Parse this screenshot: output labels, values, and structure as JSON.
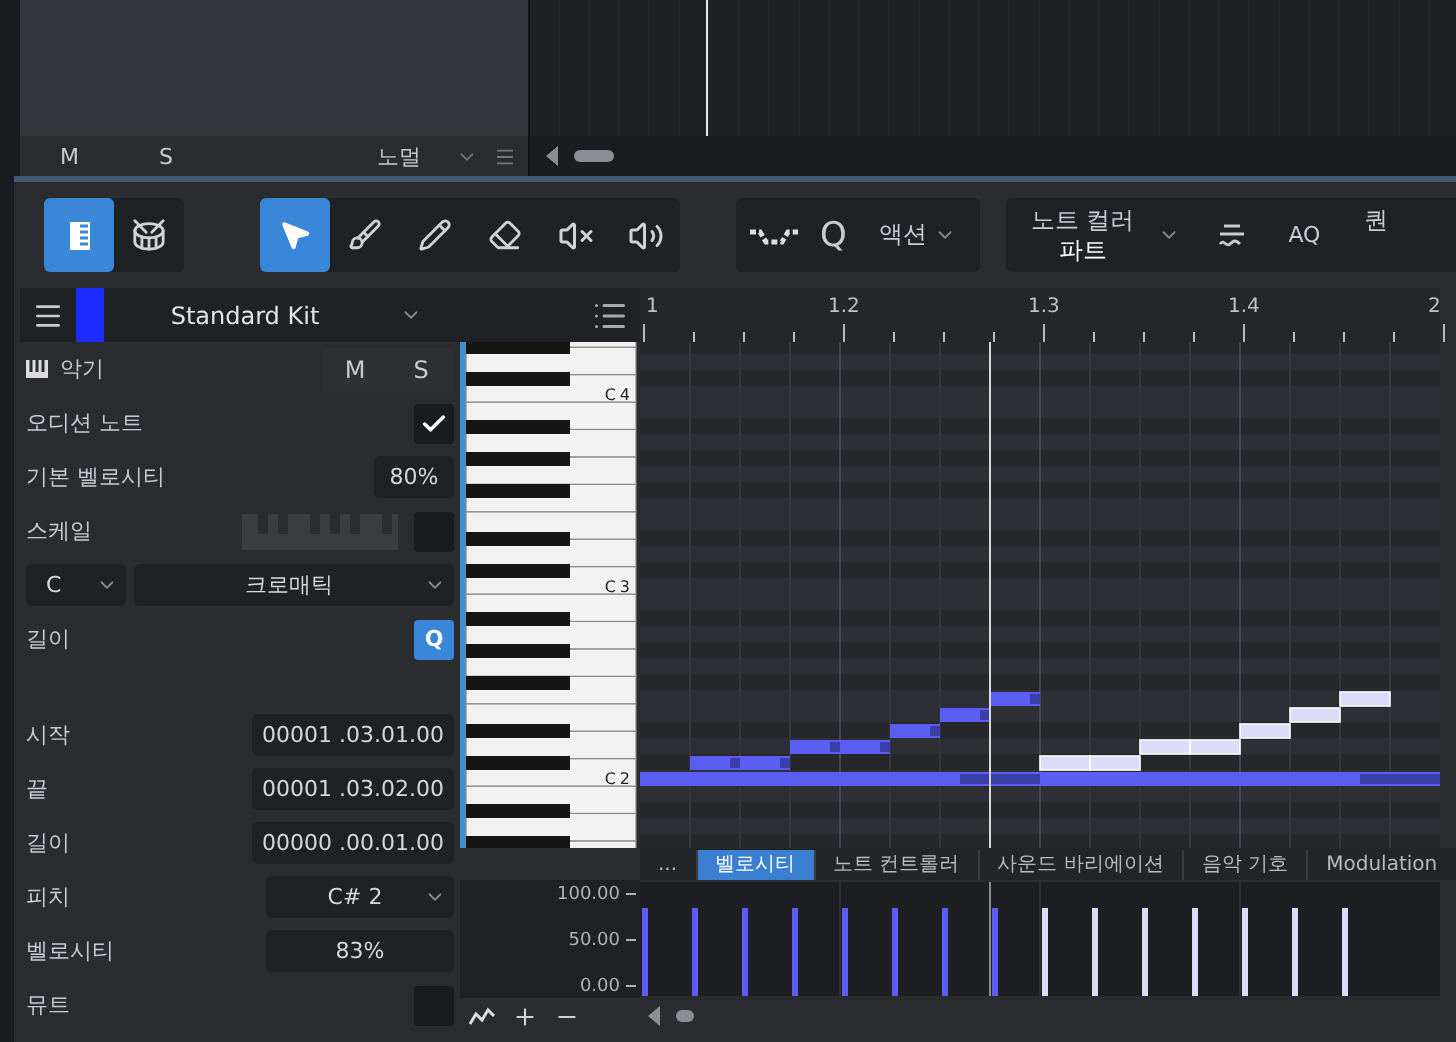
{
  "track_panel": {
    "mute": "M",
    "solo": "S",
    "mode": "노멀"
  },
  "toolbar": {
    "views": [
      {
        "kind": "editor",
        "selected": true
      },
      {
        "kind": "drum",
        "selected": false
      }
    ],
    "tools": [
      {
        "kind": "arrow",
        "selected": true
      },
      {
        "kind": "brush",
        "selected": false
      },
      {
        "kind": "pencil",
        "selected": false
      },
      {
        "kind": "eraser",
        "selected": false
      },
      {
        "kind": "mute",
        "selected": false
      },
      {
        "kind": "listen",
        "selected": false
      }
    ],
    "quantize": "Q",
    "action": "액션",
    "note_color_label": "노트 컬러",
    "note_color_value": "파트",
    "aq": "AQ",
    "quantize_cut": "퀀"
  },
  "inspector": {
    "instrument": "Standard Kit",
    "instrument_label": "악기",
    "mute": "M",
    "solo": "S",
    "audition": {
      "label": "오디션 노트",
      "checked": true
    },
    "default_velocity": {
      "label": "기본 벨로시티",
      "value": "80%"
    },
    "scale": {
      "label": "스케일",
      "checked": false
    },
    "key": "C",
    "scale_type": "크로매틱",
    "length": {
      "label": "길이",
      "quantize": "Q",
      "on": true
    },
    "note_fields": [
      {
        "label": "시작",
        "value": "00001 .03.01.00",
        "kind": "text"
      },
      {
        "label": "끝",
        "value": "00001 .03.02.00",
        "kind": "text"
      },
      {
        "label": "길이",
        "value": "00000 .00.01.00",
        "kind": "text"
      },
      {
        "label": "피치",
        "value": "C# 2",
        "kind": "dropdown"
      },
      {
        "label": "벨로시티",
        "value": "83%",
        "kind": "text"
      }
    ],
    "mute_note": {
      "label": "뮤트",
      "checked": false
    }
  },
  "ruler": [
    "1",
    "1.2",
    "1.3",
    "1.4",
    "2"
  ],
  "keyboard_labels": [
    "C4",
    "C3",
    "C2"
  ],
  "piano_roll": {
    "notes": [
      {
        "color": "#5a5ef2"
      },
      {
        "color": "#5a5ef2"
      },
      {
        "color": "#5a5ef2"
      },
      {
        "color": "#5a5ef2"
      },
      {
        "color": "#5a5ef2"
      },
      {
        "color": "#5a5ef2"
      },
      {
        "color": "#5a5ef2"
      },
      {
        "color": "#5a5ef2"
      },
      {
        "color": "#5a5ef2"
      },
      {
        "color": "#dcdcf8"
      },
      {
        "color": "#dcdcf8"
      },
      {
        "color": "#dcdcf8"
      },
      {
        "color": "#dcdcf8"
      },
      {
        "color": "#dcdcf8"
      },
      {
        "color": "#dcdcf8"
      },
      {
        "color": "#dcdcf8"
      }
    ]
  },
  "lane_tabs": [
    {
      "label": "...",
      "selected": false
    },
    {
      "label": "벨로시티",
      "selected": true
    },
    {
      "label": "노트 컨트롤러",
      "selected": false
    },
    {
      "label": "사운드 바리에이션",
      "selected": false
    },
    {
      "label": "음악 기호",
      "selected": false
    },
    {
      "label": "Modulation",
      "selected": false
    }
  ],
  "velocity_lane": {
    "tick_labels": [
      "100.00",
      "50.00",
      "0.00"
    ]
  }
}
